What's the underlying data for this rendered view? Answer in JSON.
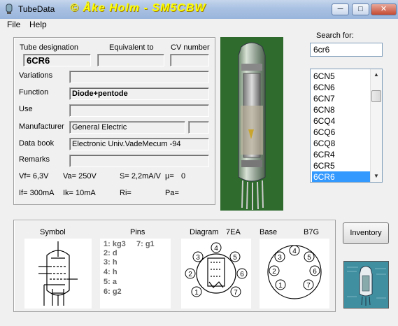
{
  "window": {
    "title": "TubeData",
    "watermark": "© Åke Holm - SM5CBW",
    "minimize_label": "─",
    "maximize_label": "□",
    "close_label": "✕"
  },
  "menu": {
    "file_label": "File",
    "help_label": "Help"
  },
  "info": {
    "tube_designation_label": "Tube designation",
    "tube_designation_value": "6CR6",
    "equivalent_label": "Equivalent to",
    "equivalent_value": "",
    "cv_label": "CV number",
    "cv_value": "",
    "variations_label": "Variations",
    "variations_value": "",
    "function_label": "Function",
    "function_value": "Diode+pentode",
    "use_label": "Use",
    "use_value": "",
    "manufacturer_label": "Manufacturer",
    "manufacturer_value": "General Electric",
    "manufacturer_extra": "",
    "databook_label": "Data book",
    "databook_value": "Electronic Univ.VadeMecum -94",
    "remarks_label": "Remarks",
    "remarks_value": ""
  },
  "params": {
    "vf": "Vf= 6,3V",
    "va": "Va= 250V",
    "s": "S= 2,2mA/V",
    "mu": "µ=",
    "mu_value": "0",
    "if": "If= 300mA",
    "ik": "Ik= 10mA",
    "ri": "Ri=",
    "pa": "Pa="
  },
  "search": {
    "label": "Search for:",
    "value": "6cr6",
    "list": [
      "6CN5",
      "6CN6",
      "6CN7",
      "6CN8",
      "6CQ4",
      "6CQ6",
      "6CQ8",
      "6CR4",
      "6CR5",
      "6CR6"
    ],
    "selected": "6CR6"
  },
  "bottom": {
    "symbol_label": "Symbol",
    "pins_label": "Pins",
    "diagram_label": "Diagram",
    "diagram_code": "7EA",
    "base_label": "Base",
    "base_code": "B7G",
    "pins": [
      "1: kg3",
      "2: d",
      "3: h",
      "4: h",
      "5: a",
      "6: g2",
      "7: g1"
    ],
    "diagram_pin_numbers": [
      "1",
      "2",
      "3",
      "4",
      "5",
      "6",
      "7"
    ],
    "base_pin_numbers": [
      "1",
      "2",
      "3",
      "4",
      "5",
      "6",
      "7"
    ]
  },
  "inventory_label": "Inventory",
  "colors": {
    "selection": "#3399ff",
    "watermark": "#ffff00",
    "photo_bg": "#2f6b2d"
  }
}
